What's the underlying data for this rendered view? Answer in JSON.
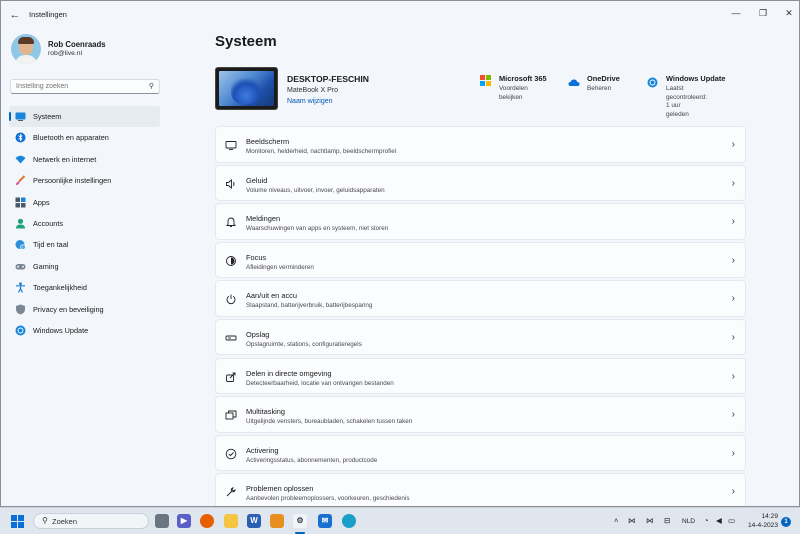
{
  "window": {
    "title": "Instellingen",
    "back_icon": "back-arrow-icon",
    "minimize_glyph": "—",
    "maximize_glyph": "❐",
    "close_glyph": "✕"
  },
  "user": {
    "name": "Rob Coenraads",
    "email": "rob@live.nl"
  },
  "search": {
    "placeholder": "Instelling zoeken"
  },
  "sidebar": {
    "items": [
      {
        "label": "Systeem",
        "icon": "monitor-icon"
      },
      {
        "label": "Bluetooth en apparaten",
        "icon": "bluetooth-icon"
      },
      {
        "label": "Netwerk en internet",
        "icon": "wifi-icon"
      },
      {
        "label": "Persoonlijke instellingen",
        "icon": "brush-icon"
      },
      {
        "label": "Apps",
        "icon": "apps-icon"
      },
      {
        "label": "Accounts",
        "icon": "account-icon"
      },
      {
        "label": "Tijd en taal",
        "icon": "globe-clock-icon"
      },
      {
        "label": "Gaming",
        "icon": "gamepad-icon"
      },
      {
        "label": "Toegankelijkheid",
        "icon": "accessibility-icon"
      },
      {
        "label": "Privacy en beveiliging",
        "icon": "shield-icon"
      },
      {
        "label": "Windows Update",
        "icon": "update-icon"
      }
    ]
  },
  "main": {
    "title": "Systeem",
    "device": {
      "name": "DESKTOP-FESCHIN",
      "model": "MateBook X Pro",
      "rename": "Naam wijzigen"
    },
    "quick": [
      {
        "title": "Microsoft 365",
        "subtitle": "Voordelen bekijken",
        "icon": "microsoft365-icon"
      },
      {
        "title": "OneDrive",
        "subtitle": "Beheren",
        "icon": "onedrive-icon"
      },
      {
        "title": "Windows Update",
        "subtitle_line1": "Laatst gecontroleerd: 1 uur",
        "subtitle_line2": "geleden",
        "icon": "windows-update-icon"
      }
    ],
    "cards": [
      {
        "title": "Beeldscherm",
        "subtitle": "Monitoren, helderheid, nachtlamp, beeldschermprofiel",
        "icon": "display-icon"
      },
      {
        "title": "Geluid",
        "subtitle": "Volume niveaus, uitvoer, invoer, geluidsapparaten",
        "icon": "speaker-icon"
      },
      {
        "title": "Meldingen",
        "subtitle": "Waarschuwingen van apps en systeem, niet storen",
        "icon": "bell-icon"
      },
      {
        "title": "Focus",
        "subtitle": "Afleidingen verminderen",
        "icon": "focus-icon"
      },
      {
        "title": "Aan/uit en accu",
        "subtitle": "Slaapstand, batterijverbruik, batterijbesparing",
        "icon": "power-icon"
      },
      {
        "title": "Opslag",
        "subtitle": "Opslagruimte, stations, configuratieregels",
        "icon": "storage-icon"
      },
      {
        "title": "Delen in directe omgeving",
        "subtitle": "Detecteerbaarheid, locatie van ontvangen bestanden",
        "icon": "share-icon"
      },
      {
        "title": "Multitasking",
        "subtitle": "Uitgelijnde vensters, bureaubladen, schakelen tussen taken",
        "icon": "multitasking-icon"
      },
      {
        "title": "Activering",
        "subtitle": "Activeringsstatus, abonnementen, productcode",
        "icon": "check-circle-icon"
      },
      {
        "title": "Problemen oplossen",
        "subtitle": "Aanbevolen probleemoplossers, voorkeuren, geschiedenis",
        "icon": "wrench-icon"
      }
    ]
  },
  "taskbar": {
    "search_label": "Zoeken",
    "language": "NLD",
    "time": "14:29",
    "date": "14-4-2023",
    "notification_count": "1"
  },
  "colors": {
    "accent": "#0067c0",
    "window_bg": "#f3f6fb",
    "card_bg": "#fbfcfe"
  }
}
